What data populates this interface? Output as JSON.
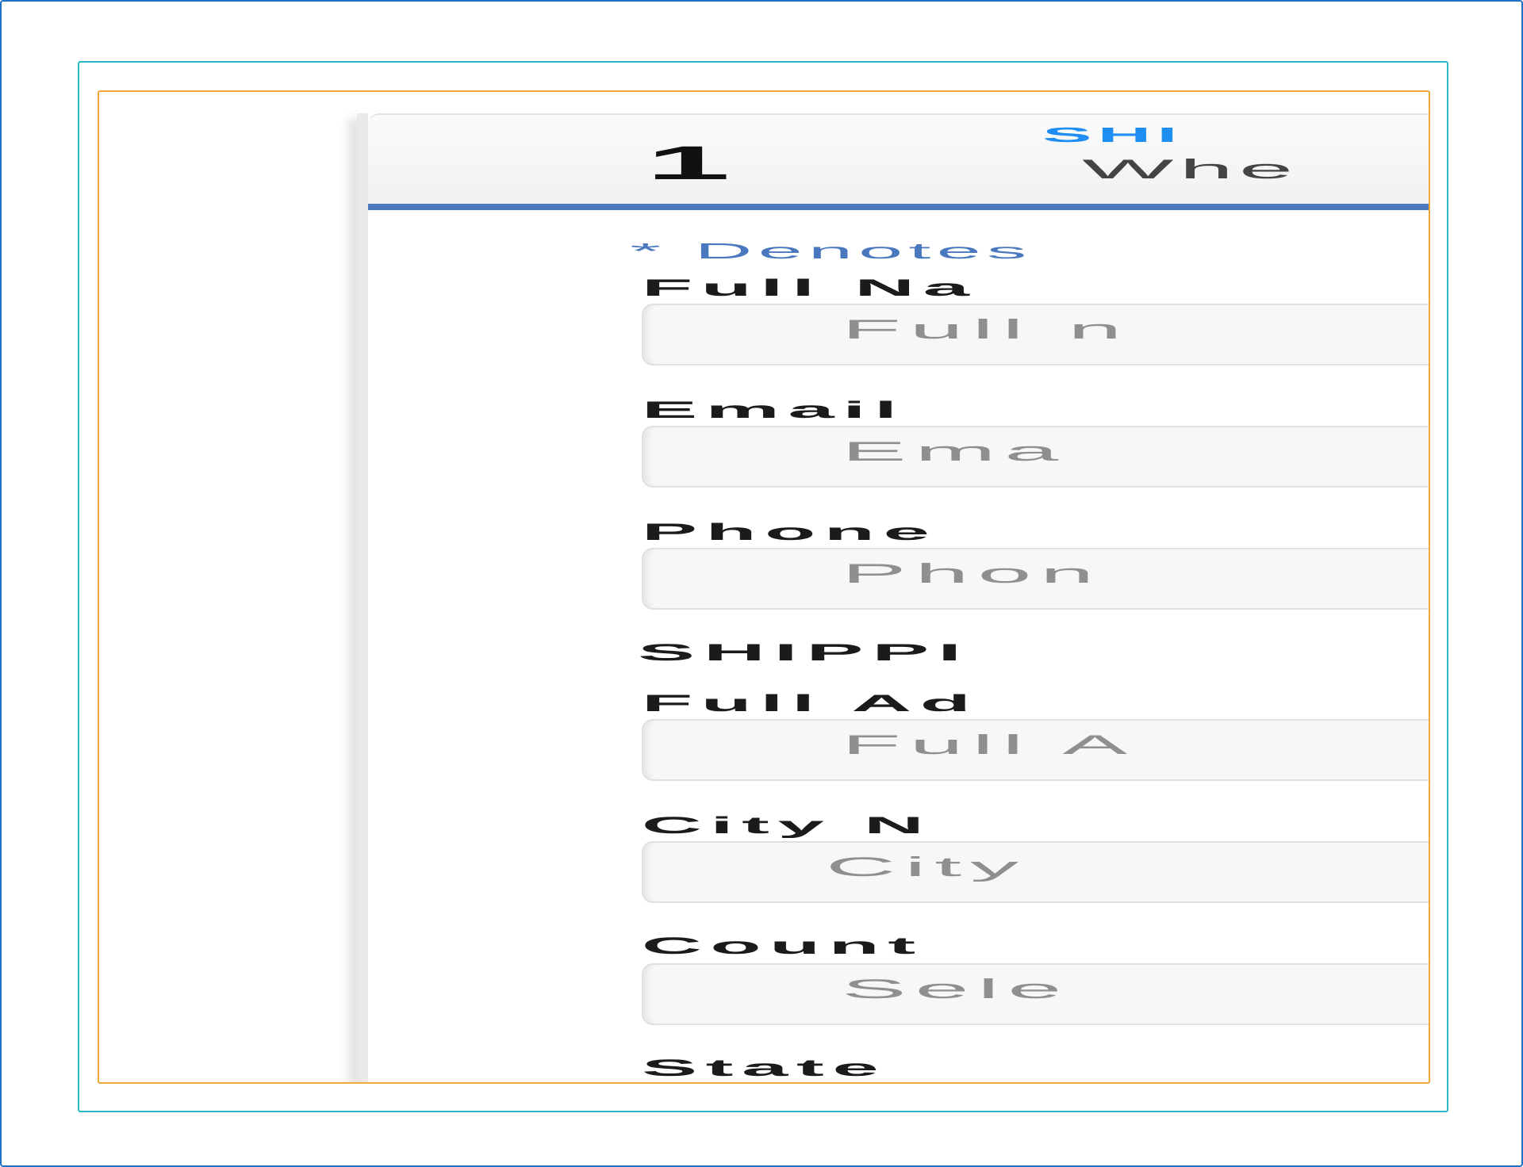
{
  "wizard": {
    "step_number": "1",
    "step_title": "SHI",
    "step_subtitle": "Whe"
  },
  "form": {
    "required_note": "* Denotes",
    "full_name": {
      "label": "Full Na",
      "placeholder": "Full n"
    },
    "email": {
      "label": "Email",
      "placeholder": "Ema"
    },
    "phone": {
      "label": "Phone",
      "placeholder": "Phon"
    },
    "shipping_section": "SHIPPI",
    "full_address": {
      "label": "Full Ad",
      "placeholder": "Full A"
    },
    "city_name": {
      "label": "City N",
      "placeholder": "City"
    },
    "country": {
      "label": "Count",
      "placeholder": "Sele"
    },
    "state": {
      "label": "State"
    }
  },
  "colors": {
    "outer_border": "#1a73c8",
    "teal_border": "#2ab8c4",
    "orange_border": "#f0a83a",
    "header_accent": "#4a78bf",
    "title_blue": "#1e8ef2"
  }
}
